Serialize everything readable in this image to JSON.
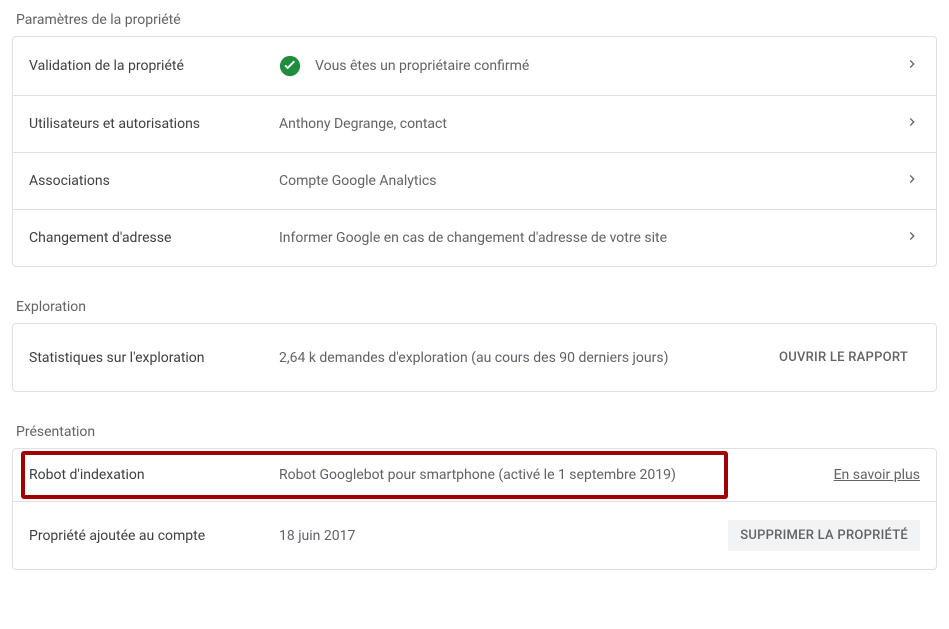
{
  "sections": {
    "property_settings": {
      "title": "Paramètres de la propriété",
      "rows": {
        "validation": {
          "label": "Validation de la propriété",
          "value": "Vous êtes un propriétaire confirmé"
        },
        "users": {
          "label": "Utilisateurs et autorisations",
          "value": "Anthony Degrange, contact"
        },
        "associations": {
          "label": "Associations",
          "value": "Compte Google Analytics"
        },
        "address_change": {
          "label": "Changement d'adresse",
          "value": "Informer Google en cas de changement d'adresse de votre site"
        }
      }
    },
    "exploration": {
      "title": "Exploration",
      "rows": {
        "stats": {
          "label": "Statistiques sur l'exploration",
          "value": "2,64 k demandes d'exploration (au cours des 90 derniers jours)",
          "action": "OUVRIR LE RAPPORT"
        }
      }
    },
    "presentation": {
      "title": "Présentation",
      "rows": {
        "crawler": {
          "label": "Robot d'indexation",
          "value": "Robot Googlebot pour smartphone (activé le 1 septembre 2019)",
          "link": "En savoir plus"
        },
        "property_added": {
          "label": "Propriété ajoutée au compte",
          "value": "18 juin 2017",
          "action": "SUPPRIMER LA PROPRIÉTÉ"
        }
      }
    }
  }
}
